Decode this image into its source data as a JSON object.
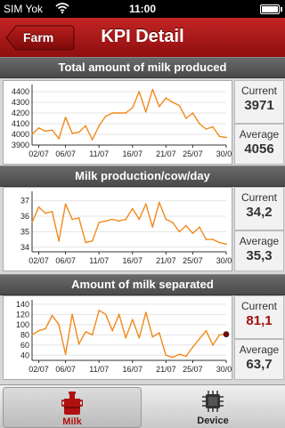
{
  "status": {
    "carrier": "SIM Yok",
    "time": "11:00",
    "battery_level": 1.0
  },
  "nav": {
    "back_label": "Farm",
    "title": "KPI Detail"
  },
  "sections": [
    {
      "title": "Total amount of milk produced",
      "current_label": "Current",
      "current_value": "3971",
      "average_label": "Average",
      "average_value": "4056",
      "current_color": "#333333"
    },
    {
      "title": "Milk production/cow/day",
      "current_label": "Current",
      "current_value": "34,2",
      "average_label": "Average",
      "average_value": "35,3",
      "current_color": "#333333"
    },
    {
      "title": "Amount of milk separated",
      "current_label": "Current",
      "current_value": "81,1",
      "average_label": "Average",
      "average_value": "63,7",
      "current_color": "#a01010"
    }
  ],
  "tabs": [
    {
      "label": "Milk",
      "icon": "milk-can-icon",
      "active": true,
      "color": "#b01010"
    },
    {
      "label": "Device",
      "icon": "chip-icon",
      "active": false,
      "color": "#222222"
    }
  ],
  "chart_data": [
    {
      "type": "line",
      "x": [
        "01/07",
        "02/07",
        "03/07",
        "04/07",
        "05/07",
        "06/07",
        "07/07",
        "08/07",
        "09/07",
        "10/07",
        "11/07",
        "12/07",
        "13/07",
        "14/07",
        "15/07",
        "16/07",
        "17/07",
        "18/07",
        "19/07",
        "20/07",
        "21/07",
        "22/07",
        "23/07",
        "24/07",
        "25/07",
        "26/07",
        "27/07",
        "28/07",
        "29/07",
        "30/07"
      ],
      "xticks": [
        "02/07",
        "06/07",
        "11/07",
        "16/07",
        "21/07",
        "25/07",
        "30/07"
      ],
      "yticks": [
        3900,
        4000,
        4100,
        4200,
        4300,
        4400
      ],
      "ylim": [
        3900,
        4450
      ],
      "values": [
        4000,
        4060,
        4030,
        4040,
        3960,
        4160,
        4010,
        4020,
        4080,
        3950,
        4080,
        4170,
        4200,
        4200,
        4200,
        4250,
        4400,
        4210,
        4420,
        4260,
        4340,
        4300,
        4270,
        4150,
        4200,
        4100,
        4050,
        4070,
        3980,
        3971
      ],
      "color": "#f08a1c"
    },
    {
      "type": "line",
      "x": [
        "01/07",
        "02/07",
        "03/07",
        "04/07",
        "05/07",
        "06/07",
        "07/07",
        "08/07",
        "09/07",
        "10/07",
        "11/07",
        "12/07",
        "13/07",
        "14/07",
        "15/07",
        "16/07",
        "17/07",
        "18/07",
        "19/07",
        "20/07",
        "21/07",
        "22/07",
        "23/07",
        "24/07",
        "25/07",
        "26/07",
        "27/07",
        "28/07",
        "29/07",
        "30/07"
      ],
      "xticks": [
        "02/07",
        "06/07",
        "11/07",
        "16/07",
        "21/07",
        "25/07",
        "30/07"
      ],
      "yticks": [
        34,
        35,
        36,
        37
      ],
      "ylim": [
        33.7,
        37.5
      ],
      "values": [
        35.6,
        36.6,
        36.2,
        36.3,
        34.4,
        36.8,
        35.8,
        35.9,
        34.3,
        34.4,
        35.6,
        35.7,
        35.8,
        35.7,
        35.8,
        36.5,
        35.8,
        36.8,
        35.3,
        36.9,
        35.8,
        35.6,
        35.0,
        35.4,
        34.9,
        35.3,
        34.5,
        34.5,
        34.3,
        34.2
      ],
      "color": "#f08a1c"
    },
    {
      "type": "line",
      "x": [
        "01/07",
        "02/07",
        "03/07",
        "04/07",
        "05/07",
        "06/07",
        "07/07",
        "08/07",
        "09/07",
        "10/07",
        "11/07",
        "12/07",
        "13/07",
        "14/07",
        "15/07",
        "16/07",
        "17/07",
        "18/07",
        "19/07",
        "20/07",
        "21/07",
        "22/07",
        "23/07",
        "24/07",
        "25/07",
        "26/07",
        "27/07",
        "28/07",
        "29/07",
        "30/07"
      ],
      "xticks": [
        "02/07",
        "06/07",
        "11/07",
        "16/07",
        "21/07",
        "25/07",
        "30/07"
      ],
      "yticks": [
        40,
        60,
        80,
        100,
        120,
        140
      ],
      "ylim": [
        30,
        145
      ],
      "values": [
        80,
        88,
        92,
        118,
        100,
        42,
        120,
        62,
        86,
        80,
        128,
        120,
        88,
        120,
        74,
        110,
        74,
        124,
        76,
        84,
        40,
        36,
        42,
        38,
        56,
        72,
        88,
        60,
        80,
        81.1
      ],
      "color": "#f08a1c",
      "last_point_color": "#8b0000"
    }
  ]
}
